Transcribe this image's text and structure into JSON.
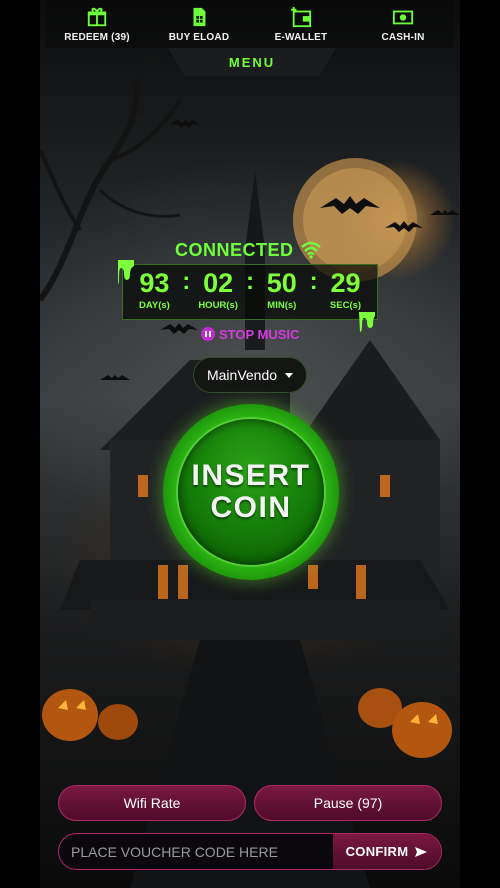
{
  "menu": {
    "items": [
      {
        "label": "REDEEM (39)",
        "icon": "gift-icon"
      },
      {
        "label": "BUY ELOAD",
        "icon": "sim-card-icon"
      },
      {
        "label": "E-WALLET",
        "icon": "wallet-icon"
      },
      {
        "label": "CASH-IN",
        "icon": "cash-icon"
      }
    ],
    "tab_label": "MENU"
  },
  "status": {
    "connected_label": "CONNECTED",
    "icon": "wifi-icon"
  },
  "timer": {
    "days": "93",
    "days_label": "DAY(s)",
    "hours": "02",
    "hours_label": "HOUR(s)",
    "mins": "50",
    "mins_label": "MIN(s)",
    "secs": "29",
    "secs_label": "SEC(s)",
    "separator": ":"
  },
  "music": {
    "label": "STOP MUSIC",
    "icon": "pause-icon"
  },
  "vendo": {
    "selected": "MainVendo"
  },
  "coin_button": {
    "line1": "INSERT",
    "line2": "COIN"
  },
  "actions": {
    "wifi_rate": "Wifi Rate",
    "pause": "Pause (97)"
  },
  "voucher": {
    "placeholder": "PLACE VOUCHER CODE HERE",
    "value": "",
    "confirm_label": "CONFIRM",
    "confirm_icon": "send-icon"
  },
  "colors": {
    "accent_green": "#6dff3a",
    "magenta": "#d63ae0",
    "button_maroon": "#7a1840"
  }
}
